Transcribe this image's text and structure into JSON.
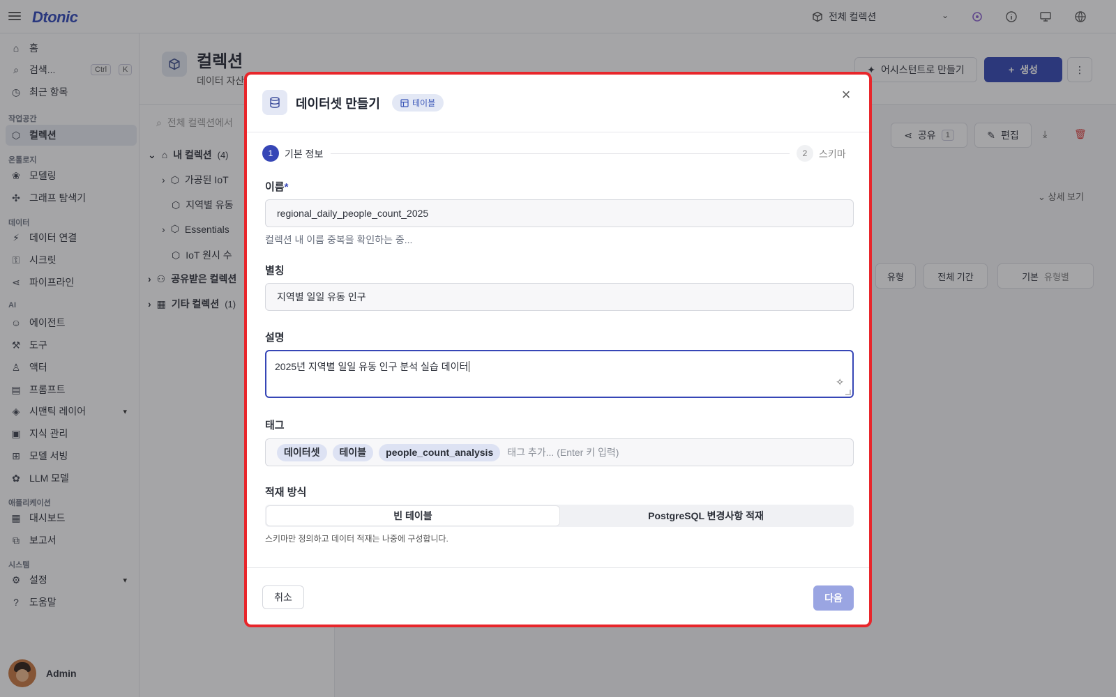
{
  "topbar": {
    "logo": "Dtonic",
    "collection_selector": "전체 컬렉션"
  },
  "sidebar": {
    "home": "홈",
    "search": "검색...",
    "search_kbd_ctrl": "Ctrl",
    "search_kbd_k": "K",
    "recent": "최근 항목",
    "sections": {
      "workspace": "작업공간",
      "ontology": "온톨로지",
      "data": "데이터",
      "ai": "AI",
      "apps": "애플리케이션",
      "system": "시스템"
    },
    "items": {
      "collection": "컬렉션",
      "modeling": "모델링",
      "graph": "그래프 탐색기",
      "data_connect": "데이터 연결",
      "secret": "시크릿",
      "pipeline": "파이프라인",
      "agent": "에이전트",
      "tool": "도구",
      "actor": "액터",
      "prompt": "프롬프트",
      "semantic": "시맨틱 레이어",
      "knowledge": "지식 관리",
      "model_serving": "모델 서빙",
      "llm": "LLM 모델",
      "dashboard": "대시보드",
      "report": "보고서",
      "settings": "설정",
      "help": "도움말"
    },
    "user": "Admin"
  },
  "page": {
    "title": "컬렉션",
    "subtitle": "데이터 자산",
    "search_placeholder": "전체 컬렉션에서",
    "assist_button": "어시스턴트로 만들기",
    "create_button": "생성",
    "share_button": "공유",
    "share_count": "1",
    "edit_button": "편집",
    "detail_toggle": "상세 보기",
    "filter_type": "유형",
    "filter_period": "전체 기간",
    "view_basic": "기본",
    "view_bytype": "유형별"
  },
  "tree": {
    "my_collections": "내 컬렉션",
    "my_count": "(4)",
    "items": [
      "가공된 IoT",
      "지역별 유동",
      "Essentials",
      "IoT 원시 수"
    ],
    "shared": "공유받은 컬렉션",
    "other": "기타 컬렉션",
    "other_count": "(1)"
  },
  "modal": {
    "title": "데이터셋 만들기",
    "badge": "테이블",
    "steps": [
      {
        "num": "1",
        "label": "기본 정보"
      },
      {
        "num": "2",
        "label": "스키마"
      }
    ],
    "name_label": "이름",
    "name_required": "*",
    "name_value": "regional_daily_people_count_2025",
    "name_help": "컬렉션 내 이름 중복을 확인하는 중...",
    "alias_label": "별칭",
    "alias_value": "지역별 일일 유동 인구",
    "desc_label": "설명",
    "desc_value": "2025년 지역별 일일 유동 인구 분석 실습 데이터",
    "tags_label": "태그",
    "tags": [
      "데이터셋",
      "테이블",
      "people_count_analysis"
    ],
    "tags_placeholder": "태그 추가... (Enter 키 입력)",
    "load_label": "적재 방식",
    "load_options": [
      "빈 테이블",
      "PostgreSQL 변경사항 적재"
    ],
    "load_help": "스키마만 정의하고 데이터 적재는 나중에 구성합니다.",
    "cancel": "취소",
    "next": "다음"
  },
  "colors": {
    "primary": "#2f44b3",
    "highlight_border": "#e8262b"
  }
}
